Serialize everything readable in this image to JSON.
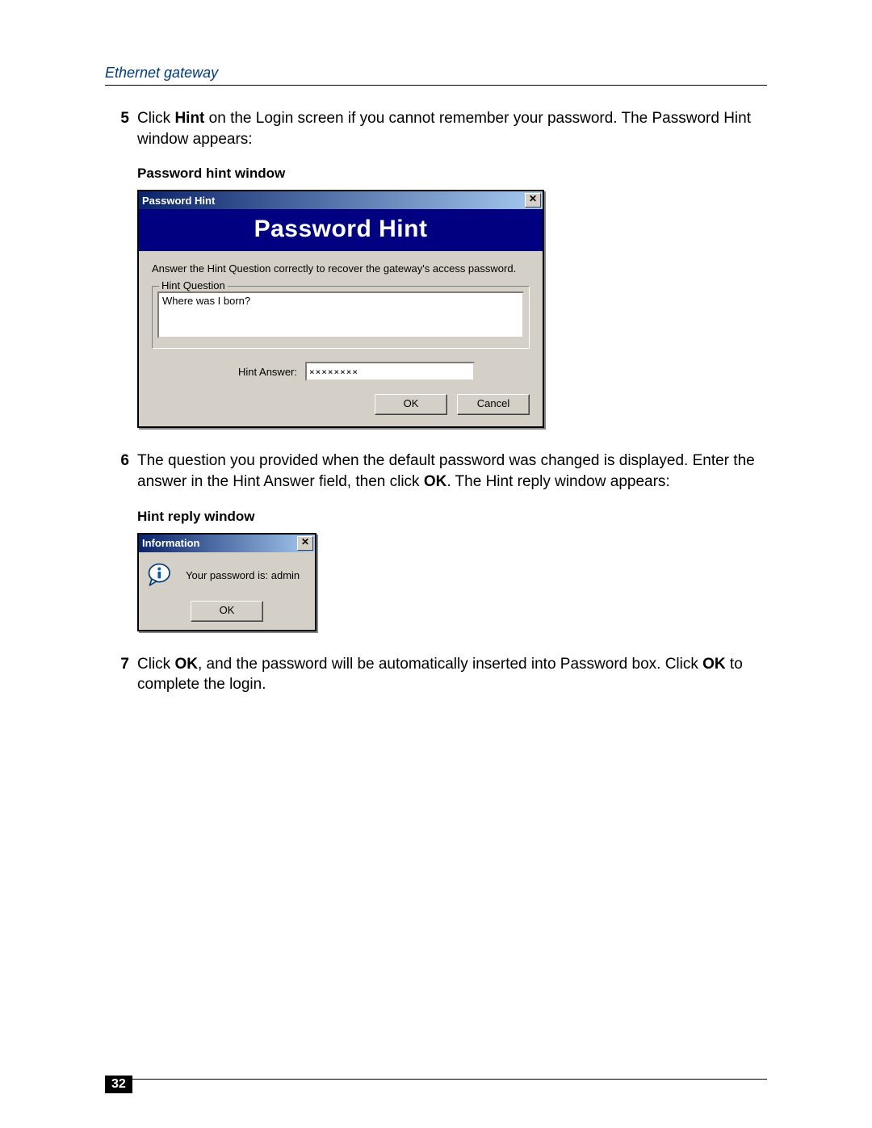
{
  "header": "Ethernet gateway",
  "steps": {
    "s5": {
      "num": "5",
      "pre": "Click ",
      "b1": "Hint",
      "post": " on the Login screen if you cannot remember your password. The Password Hint window appears:"
    },
    "s6": {
      "num": "6",
      "pre": "The question you provided when the default password was changed is displayed. Enter the answer in the Hint Answer field, then click ",
      "b1": "OK",
      "post": ". The Hint reply window appears:"
    },
    "s7": {
      "num": "7",
      "pre": "Click ",
      "b1": "OK",
      "mid": ", and the password will be automatically inserted into Password box. Click ",
      "b2": "OK",
      "post": " to complete the login."
    }
  },
  "captions": {
    "c1": "Password hint window",
    "c2": "Hint reply window"
  },
  "dialog1": {
    "title": "Password Hint",
    "banner": "Password Hint",
    "instruction": "Answer the Hint Question correctly to recover the gateway's access password.",
    "legend": "Hint Question",
    "question": "Where was I born?",
    "answer_label": "Hint Answer:",
    "answer_value": "××××××××",
    "ok": "OK",
    "cancel": "Cancel",
    "close": "✕"
  },
  "dialog2": {
    "title": "Information",
    "message": "Your password is: admin",
    "ok": "OK",
    "close": "✕"
  },
  "page_number": "32"
}
